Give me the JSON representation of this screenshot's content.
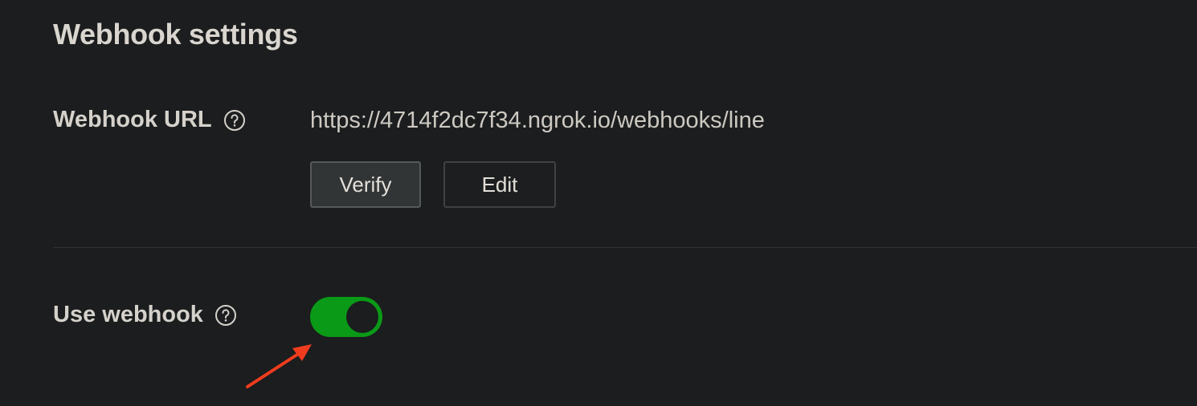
{
  "section": {
    "title": "Webhook settings"
  },
  "webhook_url": {
    "label": "Webhook URL",
    "help_icon": "question-circle-icon",
    "value": "https://4714f2dc7f34.ngrok.io/webhooks/line",
    "verify_label": "Verify",
    "edit_label": "Edit"
  },
  "use_webhook": {
    "label": "Use webhook",
    "help_icon": "question-circle-icon",
    "enabled": true
  },
  "colors": {
    "background": "#1b1d1e",
    "toggle_on": "#0a9a17",
    "annotation_arrow": "#f03c1e"
  },
  "annotation": {
    "type": "arrow",
    "points_to": "use-webhook-toggle"
  }
}
